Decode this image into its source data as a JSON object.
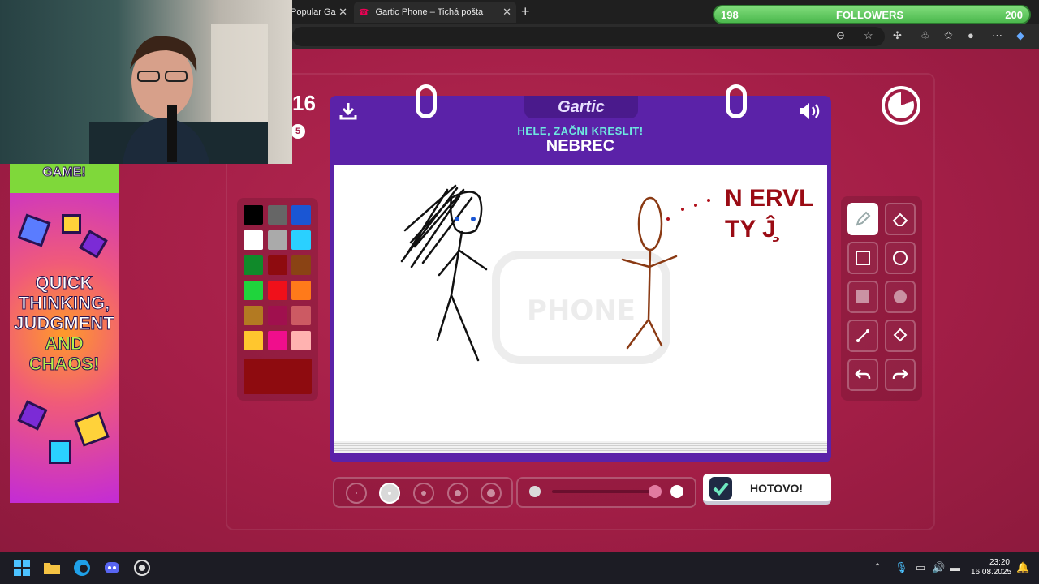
{
  "browser": {
    "tabs": [
      {
        "label": "Popular Ga"
      },
      {
        "label": "Gartic Phone – Tichá pošta"
      }
    ]
  },
  "followers": {
    "current": "198",
    "label": "FOLLOWERS",
    "goal": "200"
  },
  "game": {
    "logo": "Gartic",
    "round_partial": "16",
    "badge_partial": "5",
    "subtitle": "HELE, ZAČNI KRESLIT!",
    "prompt": "NEBREC",
    "drawing_text_line1": "N ERVL",
    "drawing_text_line2": "TY Ĵ̧",
    "watermark": "Gartic PHONE",
    "done_label": "HOTOVO!"
  },
  "palette": {
    "colors": [
      "#000000",
      "#666666",
      "#1a56d4",
      "#ffffff",
      "#aaaaaa",
      "#2ad0ff",
      "#108a2a",
      "#8e0b0f",
      "#8a4314",
      "#1fd43c",
      "#f0101a",
      "#ff7a1a",
      "#b37a22",
      "#a0104e",
      "#cc5a63",
      "#ffc62e",
      "#f00e8c",
      "#ffb2b0"
    ],
    "current": "#8e0b0f"
  },
  "ad": {
    "top_text": "GAME!",
    "line1": "QUICK",
    "line2": "THINKING,",
    "line3": "JUDGMENT",
    "line4": "AND",
    "line5": "CHAOS!"
  },
  "taskbar": {
    "time": "23:20",
    "date": "16.08.2025"
  }
}
